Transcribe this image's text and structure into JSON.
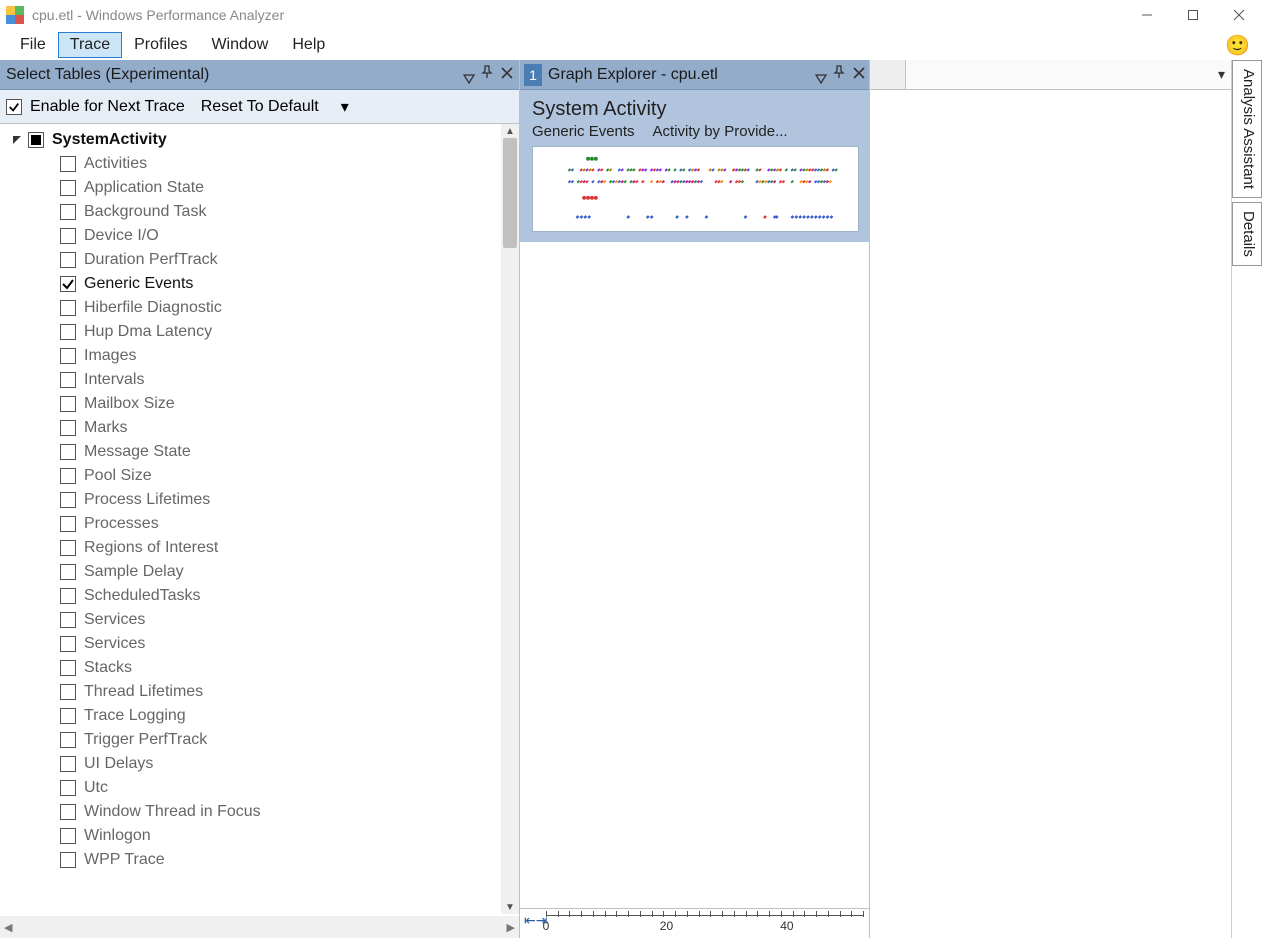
{
  "window": {
    "title": "cpu.etl - Windows Performance Analyzer"
  },
  "menu": {
    "file": "File",
    "trace": "Trace",
    "profiles": "Profiles",
    "window": "Window",
    "help": "Help"
  },
  "left": {
    "title": "Select Tables (Experimental)",
    "enable": "Enable for Next Trace",
    "reset": "Reset To Default",
    "root": "SystemActivity",
    "items": [
      {
        "label": "Activities",
        "checked": false
      },
      {
        "label": "Application State",
        "checked": false
      },
      {
        "label": "Background Task",
        "checked": false
      },
      {
        "label": "Device I/O",
        "checked": false
      },
      {
        "label": "Duration PerfTrack",
        "checked": false
      },
      {
        "label": "Generic Events",
        "checked": true
      },
      {
        "label": "Hiberfile Diagnostic",
        "checked": false
      },
      {
        "label": "Hup Dma Latency",
        "checked": false
      },
      {
        "label": "Images",
        "checked": false
      },
      {
        "label": "Intervals",
        "checked": false
      },
      {
        "label": "Mailbox Size",
        "checked": false
      },
      {
        "label": "Marks",
        "checked": false
      },
      {
        "label": "Message State",
        "checked": false
      },
      {
        "label": "Pool Size",
        "checked": false
      },
      {
        "label": "Process Lifetimes",
        "checked": false
      },
      {
        "label": "Processes",
        "checked": false
      },
      {
        "label": "Regions of Interest",
        "checked": false
      },
      {
        "label": "Sample Delay",
        "checked": false
      },
      {
        "label": "ScheduledTasks",
        "checked": false
      },
      {
        "label": "Services",
        "checked": false
      },
      {
        "label": "Services",
        "checked": false
      },
      {
        "label": "Stacks",
        "checked": false
      },
      {
        "label": "Thread Lifetimes",
        "checked": false
      },
      {
        "label": "Trace Logging",
        "checked": false
      },
      {
        "label": "Trigger PerfTrack",
        "checked": false
      },
      {
        "label": "UI Delays",
        "checked": false
      },
      {
        "label": "Utc",
        "checked": false
      },
      {
        "label": "Window Thread in Focus",
        "checked": false
      },
      {
        "label": "Winlogon",
        "checked": false
      },
      {
        "label": "WPP Trace",
        "checked": false
      }
    ]
  },
  "graph": {
    "badge": "1",
    "title": "Graph Explorer - cpu.etl",
    "card_title": "System Activity",
    "sub1": "Generic Events",
    "sub2": "Activity by Provide...",
    "timeline_ticks": [
      "0",
      "20",
      "40"
    ]
  },
  "sidetabs": {
    "assistant": "Analysis Assistant",
    "details": "Details"
  }
}
